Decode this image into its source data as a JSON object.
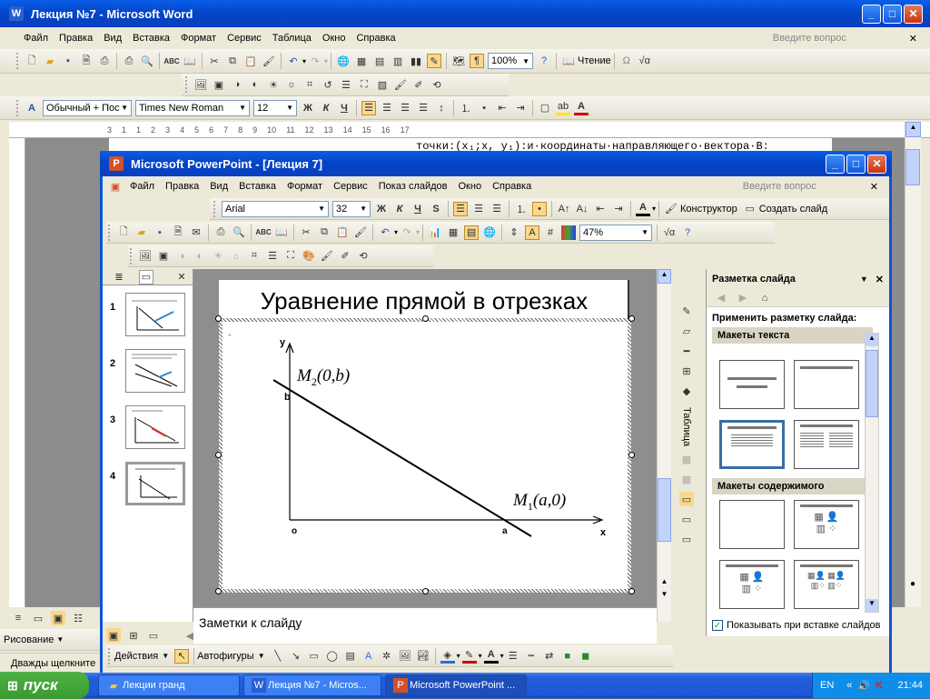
{
  "word": {
    "title": "Лекция №7 - Microsoft Word",
    "menu": [
      "Файл",
      "Правка",
      "Вид",
      "Вставка",
      "Формат",
      "Сервис",
      "Таблица",
      "Окно",
      "Справка"
    ],
    "ask": "Введите вопрос",
    "zoom": "100%",
    "reading": "Чтение",
    "style": "Обычный + Пос",
    "font": "Times New Roman",
    "size": "12",
    "ruler_marks": [
      "3",
      "1",
      "1",
      "2",
      "3",
      "4",
      "5",
      "6",
      "7",
      "8",
      "9",
      "10",
      "11",
      "12",
      "13",
      "14",
      "15",
      "16",
      "17"
    ],
    "doc_text": "точки:(x₁;x, y₁):и·координаты·направляющего·вектора·В:",
    "status_drawing": "Рисование",
    "status_hint": "Дважды щелкните"
  },
  "ppt": {
    "title": "Microsoft PowerPoint - [Лекция 7]",
    "menu": [
      "Файл",
      "Правка",
      "Вид",
      "Вставка",
      "Формат",
      "Сервис",
      "Показ слайдов",
      "Окно",
      "Справка"
    ],
    "ask": "Введите вопрос",
    "font": "Arial",
    "size": "32",
    "designer": "Конструктор",
    "new_slide": "Создать слайд",
    "zoom": "47%",
    "slide_numbers": [
      "1",
      "2",
      "3",
      "4"
    ],
    "notes": "Заметки к слайду",
    "draw_actions": "Действия",
    "autoshapes": "Автофигуры",
    "side_tab": "Таблица"
  },
  "slide": {
    "title": "Уравнение прямой в отрезках",
    "axis_y": "y",
    "axis_x": "x",
    "origin": "o",
    "point_b": "b",
    "point_a": "a",
    "m2_label": "M",
    "m2_sub": "2",
    "m2_coords": "(0,b)",
    "m1_label": "M",
    "m1_sub": "1",
    "m1_coords": "(a,0)"
  },
  "taskpane": {
    "title": "Разметка слайда",
    "apply": "Применить разметку слайда:",
    "text_layouts": "Макеты текста",
    "content_layouts": "Макеты содержимого",
    "show_on_insert": "Показывать при вставке слайдов"
  },
  "taskbar": {
    "start": "пуск",
    "tasks": [
      "Лекции гранд",
      "Лекция №7 - Micros...",
      "Microsoft PowerPoint ..."
    ],
    "lang": "EN",
    "clock": "21:44"
  }
}
